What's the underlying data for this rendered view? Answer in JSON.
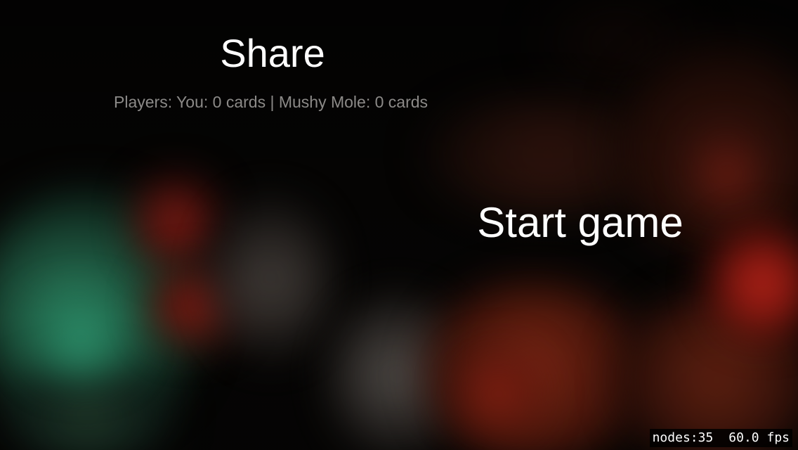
{
  "menu": {
    "share_label": "Share",
    "players_text": "Players: You: 0 cards | Mushy Mole: 0 cards",
    "start_label": "Start game"
  },
  "debug": {
    "nodes_text": "nodes:35",
    "fps_text": "60.0 fps"
  },
  "colors": {
    "text_primary": "#ffffff",
    "text_secondary": "#8c8a88",
    "accent_green": "#2f8e68",
    "accent_red": "#d32a1e"
  }
}
